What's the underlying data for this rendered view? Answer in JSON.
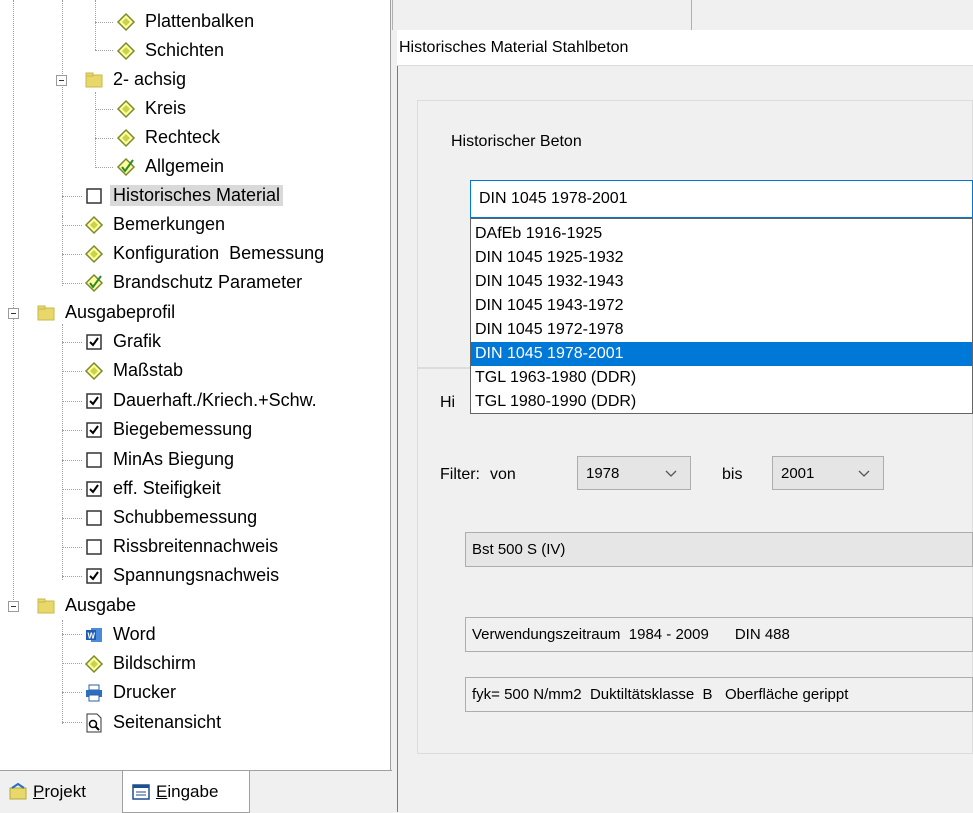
{
  "tree": {
    "items": [
      {
        "label": "Plattenbalken",
        "icon": "diamond-icon"
      },
      {
        "label": "Schichten",
        "icon": "diamond-icon"
      },
      {
        "label": "2- achsig",
        "icon": "folder-icon"
      },
      {
        "label": "Kreis",
        "icon": "diamond-icon"
      },
      {
        "label": "Rechteck",
        "icon": "diamond-icon"
      },
      {
        "label": "Allgemein",
        "icon": "diamond-check-icon"
      },
      {
        "label": "Historisches Material",
        "icon": "checkbox-unchecked-icon"
      },
      {
        "label": "Bemerkungen",
        "icon": "diamond-icon"
      },
      {
        "label": "Konfiguration  Bemessung",
        "icon": "diamond-icon"
      },
      {
        "label": "Brandschutz Parameter",
        "icon": "diamond-check-icon"
      },
      {
        "label": "Ausgabeprofil",
        "icon": "folder-icon"
      },
      {
        "label": "Grafik",
        "icon": "checkbox-checked-icon"
      },
      {
        "label": "Maßstab",
        "icon": "diamond-icon"
      },
      {
        "label": "Dauerhaft./Kriech.+Schw.",
        "icon": "checkbox-checked-icon"
      },
      {
        "label": "Biegebemessung",
        "icon": "checkbox-checked-icon"
      },
      {
        "label": "MinAs Biegung",
        "icon": "checkbox-unchecked-icon"
      },
      {
        "label": "eff. Steifigkeit",
        "icon": "checkbox-checked-icon"
      },
      {
        "label": "Schubbemessung",
        "icon": "checkbox-unchecked-icon"
      },
      {
        "label": "Rissbreitennachweis",
        "icon": "checkbox-unchecked-icon"
      },
      {
        "label": "Spannungsnachweis",
        "icon": "checkbox-checked-icon"
      },
      {
        "label": "Ausgabe",
        "icon": "folder-icon"
      },
      {
        "label": "Word",
        "icon": "word-icon"
      },
      {
        "label": "Bildschirm",
        "icon": "diamond-icon"
      },
      {
        "label": "Drucker",
        "icon": "printer-icon"
      },
      {
        "label": "Seitenansicht",
        "icon": "page-preview-icon"
      }
    ],
    "selected_label": "Historisches Material"
  },
  "tabs": [
    {
      "label": "Projekt",
      "hotkey": "P",
      "icon": "project-icon"
    },
    {
      "label": "Eingabe",
      "hotkey": "E",
      "icon": "input-form-icon"
    }
  ],
  "dialog": {
    "title": "Historisches Material Stahlbeton",
    "concrete_label": "Historischer Beton",
    "concrete_selected": "DIN 1045 1978-2001",
    "concrete_options": [
      "DAfEb 1916-1925",
      "DIN 1045 1925-1932",
      "DIN 1045 1932-1943",
      "DIN 1045 1943-1972",
      "DIN 1045 1972-1978",
      "DIN 1045 1978-2001",
      "TGL 1963-1980 (DDR)",
      "TGL 1980-1990 (DDR)"
    ],
    "second_label_partial": "Hi",
    "filter_label": "Filter:",
    "from_label": "von",
    "from_value": "1978",
    "to_label": "bis",
    "to_value": "2001",
    "steel_selected": "Bst 500 S (IV)",
    "usage_period": "Verwendungszeitraum  1984 - 2009",
    "standard": "DIN 488",
    "properties": "fyk= 500 N/mm2  Duktiltätsklasse  B   Oberfläche gerippt"
  },
  "colors": {
    "selection": "#0078d7",
    "folder": "#e8d86a",
    "diamond_fill": "#ffffa0",
    "diamond_stroke": "#7a8a2a"
  }
}
